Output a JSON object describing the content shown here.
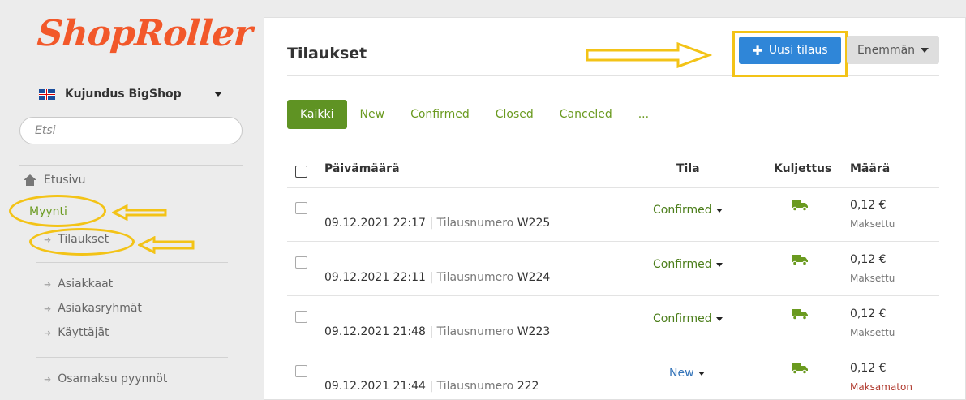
{
  "brand": {
    "logo_text": "ShopRoller",
    "logo_color": "#f2582a"
  },
  "shop": {
    "name": "Kujundus BigShop",
    "flag_icon": "uk-flag-icon"
  },
  "search": {
    "placeholder": "Etsi"
  },
  "nav": {
    "home": "Etusivu",
    "sales": "Myynti",
    "orders": "Tilaukset",
    "customers": "Asiakkaat",
    "customer_groups": "Asiakasryhmät",
    "users": "Käyttäjät",
    "installments": "Osamaksu pyynnöt"
  },
  "page": {
    "title": "Tilaukset"
  },
  "toolbar": {
    "new_order": "Uusi tilaus",
    "more": "Enemmän"
  },
  "tabs": [
    "Kaikki",
    "New",
    "Confirmed",
    "Closed",
    "Canceled",
    "..."
  ],
  "table": {
    "headers": {
      "date": "Päivämäärä",
      "status": "Tila",
      "shipping": "Kuljettus",
      "amount": "Määrä"
    },
    "rows": [
      {
        "date": "09.12.2021 22:17",
        "order_label": "Tilausnumero",
        "order_no": "W225",
        "status": "Confirmed",
        "amount": "0,12 €",
        "payment": "Maksettu"
      },
      {
        "date": "09.12.2021 22:11",
        "order_label": "Tilausnumero",
        "order_no": "W224",
        "status": "Confirmed",
        "amount": "0,12 €",
        "payment": "Maksettu"
      },
      {
        "date": "09.12.2021 21:48",
        "order_label": "Tilausnumero",
        "order_no": "W223",
        "status": "Confirmed",
        "amount": "0,12 €",
        "payment": "Maksettu"
      },
      {
        "date": "09.12.2021 21:44",
        "order_label": "Tilausnumero",
        "order_no": "222",
        "status": "New",
        "amount": "0,12 €",
        "payment": "Maksamaton"
      }
    ]
  },
  "colors": {
    "accent_green": "#5f9323",
    "primary_blue": "#2f86d8",
    "annotation_yellow": "#f3c317",
    "unpaid_red": "#b03a2e"
  }
}
